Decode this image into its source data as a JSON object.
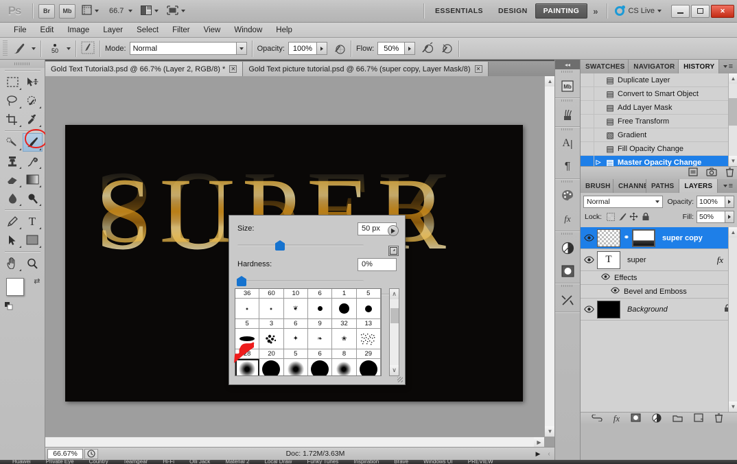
{
  "app": {
    "logo": "Ps",
    "zoom_level": "66.7",
    "bridge_button": "Br",
    "minibridge_button": "Mb"
  },
  "workspaces": {
    "items": [
      "ESSENTIALS",
      "DESIGN",
      "PAINTING"
    ],
    "active": "PAINTING",
    "more": "»",
    "cs_live": "CS Live"
  },
  "window_controls": {
    "minimize": "",
    "restore": "",
    "close": "✕"
  },
  "menu": {
    "items": [
      "File",
      "Edit",
      "Image",
      "Layer",
      "Select",
      "Filter",
      "View",
      "Window",
      "Help"
    ]
  },
  "options_bar": {
    "brush_size_label": "50",
    "mode_label": "Mode:",
    "mode_value": "Normal",
    "opacity_label": "Opacity:",
    "opacity_value": "100%",
    "flow_label": "Flow:",
    "flow_value": "50%"
  },
  "document_tabs": [
    {
      "title": "Gold Text Tutorial3.psd @ 66.7% (Layer 2, RGB/8) *",
      "close": "✕",
      "active": false
    },
    {
      "title": "Gold Text picture tutorial.psd @ 66.7%  (super copy, Layer Mask/8)",
      "close": "✕",
      "active": true
    }
  ],
  "toolbar": {
    "tools": [
      {
        "name": "rectangular-marquee-tool",
        "glyph": "⬚"
      },
      {
        "name": "move-tool",
        "glyph": "➤"
      },
      {
        "name": "lasso-tool",
        "glyph": "⌇"
      },
      {
        "name": "quick-selection-tool",
        "glyph": "✦"
      },
      {
        "name": "crop-tool",
        "glyph": "⌘"
      },
      {
        "name": "eyedropper-tool",
        "glyph": "✒"
      },
      {
        "name": "spot-healing-brush-tool",
        "glyph": "✐"
      },
      {
        "name": "brush-tool",
        "glyph": "✎"
      },
      {
        "name": "clone-stamp-tool",
        "glyph": "⚓"
      },
      {
        "name": "history-brush-tool",
        "glyph": "♫"
      },
      {
        "name": "eraser-tool",
        "glyph": "▱"
      },
      {
        "name": "gradient-tool",
        "glyph": "▤"
      },
      {
        "name": "blur-tool",
        "glyph": "◔"
      },
      {
        "name": "dodge-tool",
        "glyph": "⚲"
      },
      {
        "name": "pen-tool",
        "glyph": "✒"
      },
      {
        "name": "horizontal-type-tool",
        "glyph": "T"
      },
      {
        "name": "path-selection-tool",
        "glyph": "➤"
      },
      {
        "name": "rectangle-tool",
        "glyph": "■"
      },
      {
        "name": "hand-tool",
        "glyph": "✋"
      },
      {
        "name": "zoom-tool",
        "glyph": "⚲"
      }
    ],
    "selected_tool": "brush-tool",
    "foreground_color": "#ffffff",
    "background_color": "#ffffff",
    "swap_icon": "⇄",
    "default_icon": "◨"
  },
  "canvas": {
    "text": "SUPER",
    "background_color": "#0a0807",
    "gold_light": "#f8e7b4",
    "gold_mid": "#e8b13c",
    "gold_dark": "#a96d10"
  },
  "status_bar": {
    "zoom": "66.67%",
    "doc_info": "Doc: 1.72M/3.63M",
    "expand_arrow": "▶"
  },
  "dock_rail": {
    "collapse": "◂◂",
    "icons": [
      {
        "name": "mini-bridge-icon",
        "glyph": "Mb"
      },
      {
        "name": "brush-panel-icon",
        "glyph": "⚘"
      },
      {
        "name": "character-panel-icon",
        "glyph": "A"
      },
      {
        "name": "paragraph-panel-icon",
        "glyph": "¶"
      },
      {
        "name": "color-panel-icon",
        "glyph": "◕"
      },
      {
        "name": "styles-panel-icon",
        "glyph": "fx"
      },
      {
        "name": "adjustments-panel-icon",
        "glyph": "◑"
      },
      {
        "name": "masks-panel-icon",
        "glyph": "◉"
      },
      {
        "name": "tool-presets-icon",
        "glyph": "⚒"
      }
    ]
  },
  "history_panel": {
    "tabs": [
      {
        "label": "SWATCHES",
        "active": false
      },
      {
        "label": "NAVIGATOR",
        "active": false
      },
      {
        "label": "HISTORY",
        "active": true
      }
    ],
    "menu_icon": "≡",
    "states": [
      {
        "label": "Duplicate Layer",
        "active": false,
        "icon": "▤"
      },
      {
        "label": "Convert to Smart Object",
        "active": false,
        "icon": "▤"
      },
      {
        "label": "Add Layer Mask",
        "active": false,
        "icon": "▤"
      },
      {
        "label": "Free Transform",
        "active": false,
        "icon": "▤"
      },
      {
        "label": "Gradient",
        "active": false,
        "icon": "▧"
      },
      {
        "label": "Fill Opacity Change",
        "active": false,
        "icon": "▤"
      },
      {
        "label": "Master Opacity Change",
        "active": true,
        "icon": "▤"
      }
    ],
    "footer_icons": [
      {
        "name": "new-document-from-state-icon",
        "glyph": "▣"
      },
      {
        "name": "new-snapshot-icon",
        "glyph": "▢"
      },
      {
        "name": "delete-state-icon",
        "glyph": "♻"
      }
    ]
  },
  "layers_panel": {
    "tabs": [
      {
        "label": "BRUSH P",
        "active": false
      },
      {
        "label": "CHANNE",
        "active": false
      },
      {
        "label": "PATHS",
        "active": false
      },
      {
        "label": "LAYERS",
        "active": true
      }
    ],
    "menu_icon": "≡",
    "blend_mode": "Normal",
    "opacity_label": "Opacity:",
    "opacity_value": "100%",
    "lock_label": "Lock:",
    "lock_icons": [
      {
        "name": "lock-transparent-pixels-icon",
        "glyph": "▦"
      },
      {
        "name": "lock-image-pixels-icon",
        "glyph": "✎"
      },
      {
        "name": "lock-position-icon",
        "glyph": "✥"
      },
      {
        "name": "lock-all-icon",
        "glyph": "🔒"
      }
    ],
    "fill_label": "Fill:",
    "fill_value": "50%",
    "layers": [
      {
        "name": "super copy",
        "type": "mask",
        "active": true,
        "visible": true,
        "link": "⚭"
      },
      {
        "name": "super",
        "type": "text",
        "active": false,
        "visible": true,
        "fx": "fx"
      },
      {
        "name": "Background",
        "type": "background",
        "active": false,
        "visible": true,
        "lock": "🔒"
      }
    ],
    "effects_label": "Effects",
    "effect_items": [
      "Bevel and Emboss"
    ],
    "footer_icons": [
      {
        "name": "link-layers-icon",
        "glyph": "⚭"
      },
      {
        "name": "layer-style-icon",
        "glyph": "fx"
      },
      {
        "name": "add-layer-mask-icon",
        "glyph": "▣"
      },
      {
        "name": "new-adjustment-layer-icon",
        "glyph": "◑"
      },
      {
        "name": "new-group-icon",
        "glyph": "▭"
      },
      {
        "name": "new-layer-icon",
        "glyph": "▢"
      },
      {
        "name": "delete-layer-icon",
        "glyph": "♻"
      }
    ]
  },
  "brush_popup": {
    "size_label": "Size:",
    "size_value": "50 px",
    "size_slider_percent": 19,
    "hardness_label": "Hardness:",
    "hardness_value": "0%",
    "hardness_slider_percent": 0,
    "preset_menu_icon": "▶",
    "preset_options_icon": "◨",
    "scroll_up": "∧",
    "scroll_down": "∨",
    "preset_rows": [
      {
        "numbers": [
          "36",
          "60",
          "10",
          "6",
          "1",
          "5"
        ],
        "cells": [
          {
            "kind": "soft",
            "size": 3
          },
          {
            "kind": "soft",
            "size": 3
          },
          {
            "kind": "shape",
            "glyph": "❦"
          },
          {
            "kind": "hard",
            "size": 7
          },
          {
            "kind": "hard",
            "size": 14
          },
          {
            "kind": "hard",
            "size": 10
          }
        ]
      },
      {
        "numbers": [
          "5",
          "3",
          "6",
          "9",
          "32",
          "13"
        ],
        "cells": [
          {
            "kind": "ellipse"
          },
          {
            "kind": "scatter"
          },
          {
            "kind": "shape",
            "glyph": "✦"
          },
          {
            "kind": "shape",
            "glyph": "❧"
          },
          {
            "kind": "shape",
            "glyph": "❀"
          },
          {
            "kind": "noise"
          }
        ]
      },
      {
        "numbers": [
          "28",
          "20",
          "5",
          "6",
          "8",
          "29"
        ],
        "cells": [
          {
            "kind": "soft",
            "size": 20,
            "selected": true
          },
          {
            "kind": "hard",
            "size": 26
          },
          {
            "kind": "soft",
            "size": 20
          },
          {
            "kind": "hard",
            "size": 26
          },
          {
            "kind": "soft",
            "size": 18
          },
          {
            "kind": "hard",
            "size": 26
          }
        ]
      },
      {
        "numbers": [],
        "cells": [
          {
            "kind": "shape",
            "glyph": "◢"
          },
          {
            "kind": "shape",
            "glyph": "▓"
          },
          {
            "kind": "shape",
            "glyph": "▒"
          },
          {
            "kind": "shape",
            "glyph": "░"
          },
          {
            "kind": "shape",
            "glyph": "▲"
          },
          {
            "kind": "shape",
            "glyph": "▬"
          }
        ]
      }
    ]
  },
  "taskbar": {
    "items": [
      "Huawei",
      "Private Eye",
      "Country",
      "Teamgear",
      "Hi-Fi",
      "Olli Jack",
      "Material 2",
      "Local Draw",
      "Funky Tunes",
      "Inspiration",
      "Brave",
      "Windows UI",
      "PREVIEW"
    ]
  }
}
